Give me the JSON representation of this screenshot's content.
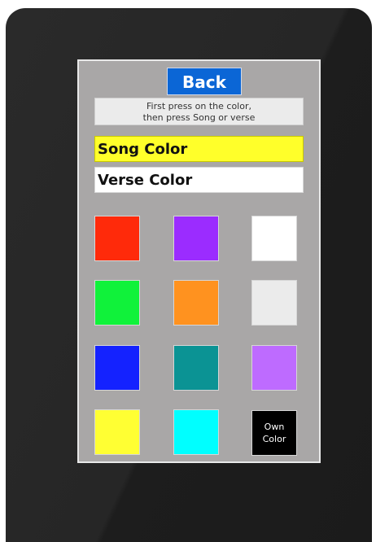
{
  "back_label": "Back",
  "instruction": {
    "line1": "First press on the color,",
    "line2": "then press Song or verse"
  },
  "song_color_label": "Song Color",
  "verse_color_label": "Verse Color",
  "colors": {
    "red": "#ff2a0a",
    "purple": "#9b2cff",
    "white": "#ffffff",
    "green": "#10f23a",
    "orange": "#ff921f",
    "light_gray": "#ebebeb",
    "blue": "#1422ff",
    "teal": "#0b9394",
    "lavender": "#be6bff",
    "yellow": "#ffff33",
    "cyan": "#00ffff",
    "black": "#000000"
  },
  "own_color": {
    "line1": "Own",
    "line2": "Color"
  }
}
